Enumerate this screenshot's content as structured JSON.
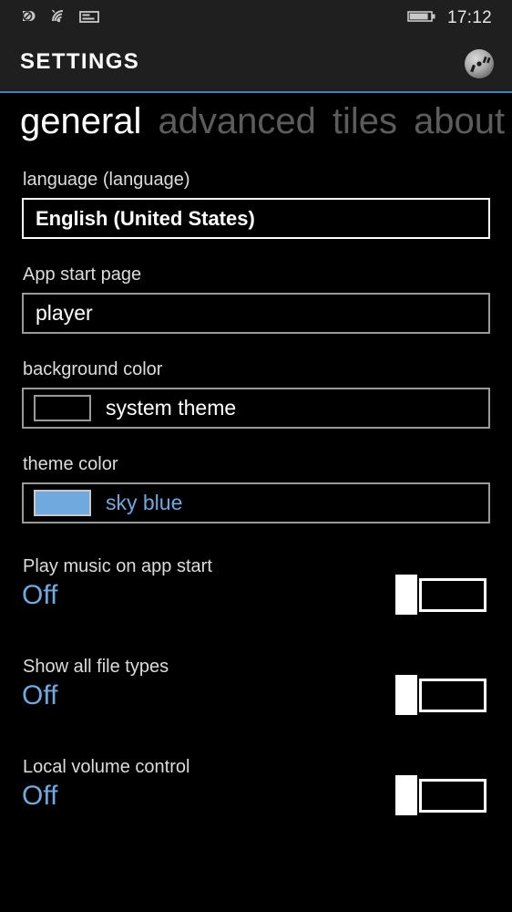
{
  "status_bar": {
    "icons": [
      "do-not-disturb-icon",
      "wifi-icon",
      "sim-card-icon",
      "battery-icon"
    ],
    "time": "17:12"
  },
  "header": {
    "title": "SETTINGS",
    "logo": "music-disc-icon"
  },
  "tabs": [
    {
      "label": "general",
      "active": true
    },
    {
      "label": "advanced",
      "active": false
    },
    {
      "label": "tiles",
      "active": false
    },
    {
      "label": "about",
      "active": false
    }
  ],
  "fields": {
    "language": {
      "label": "language (language)",
      "value": "English (United States)"
    },
    "start_page": {
      "label": "App start page",
      "value": "player"
    },
    "background_color": {
      "label": "background color",
      "value": "system theme",
      "swatch": "#000000"
    },
    "theme_color": {
      "label": "theme color",
      "value": "sky blue",
      "swatch": "#6fa9dd"
    }
  },
  "toggles": [
    {
      "label": "Play music on app start",
      "state": "Off"
    },
    {
      "label": "Show all file types",
      "state": "Off"
    },
    {
      "label": "Local volume control",
      "state": "Off"
    }
  ],
  "colors": {
    "accent": "#6fa9dd",
    "chrome": "#1f1f1f",
    "rule": "#3d7ebc",
    "background": "#000000"
  }
}
